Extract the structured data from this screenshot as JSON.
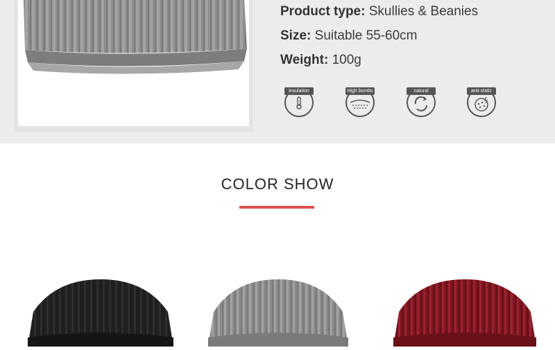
{
  "specs": [
    {
      "label": "Product type:",
      "value": "Skullies & Beanies"
    },
    {
      "label": "Size:",
      "value": "Suitable 55-60cm"
    },
    {
      "label": "Weight:",
      "value": "100g"
    }
  ],
  "badges": [
    {
      "label": "insulation",
      "icon": "thermometer-icon"
    },
    {
      "label": "High bombs",
      "icon": "fabric-texture-icon"
    },
    {
      "label": "natural",
      "icon": "recycle-icon"
    },
    {
      "label": "anti-static",
      "icon": "spark-dots-icon"
    }
  ],
  "section": {
    "title": "COLOR SHOW",
    "accent_color": "#d9534f"
  },
  "products": [
    {
      "color_name": "black",
      "color": "#1f1f1f"
    },
    {
      "color_name": "gray",
      "color": "#8a8a8a"
    },
    {
      "color_name": "wine red",
      "color": "#7d1520"
    }
  ],
  "colors": {
    "top_background": "#ececec",
    "text": "#3a3a3a"
  }
}
